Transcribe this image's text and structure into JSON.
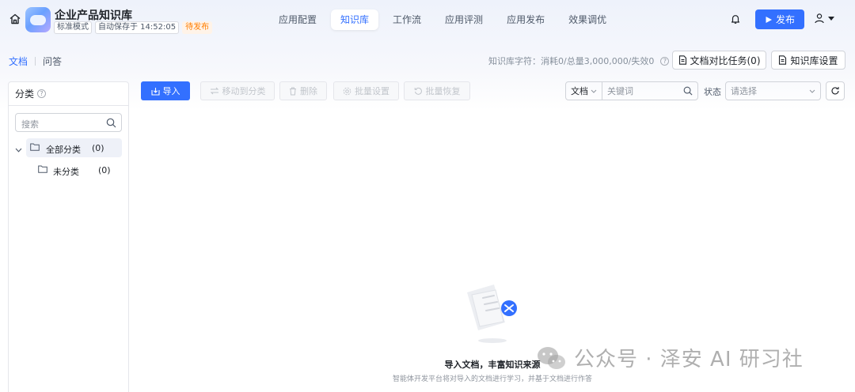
{
  "header": {
    "app_title": "企业产品知识库",
    "mode_tag": "标准模式",
    "autosave_tag": "自动保存于 14:52:05",
    "status_tag": "待发布",
    "publish_label": "发布"
  },
  "nav": {
    "tabs": [
      {
        "label": "应用配置"
      },
      {
        "label": "知识库",
        "active": true
      },
      {
        "label": "工作流"
      },
      {
        "label": "应用评测"
      },
      {
        "label": "应用发布"
      },
      {
        "label": "效果调优"
      }
    ]
  },
  "subnav": {
    "documents": "文档",
    "qa": "问答"
  },
  "stats": {
    "text": "知识库字符：消耗0/总量3,000,000/失效0",
    "compare_tasks_label": "文档对比任务(0)",
    "settings_label": "知识库设置"
  },
  "sidebar": {
    "heading": "分类",
    "search_placeholder": "搜索",
    "tree": [
      {
        "label": "全部分类",
        "count": "(0)"
      },
      {
        "label": "未分类",
        "count": "(0)"
      }
    ]
  },
  "toolbar": {
    "import_label": "导入",
    "move_label": "移动到分类",
    "delete_label": "删除",
    "batch_settings_label": "批量设置",
    "batch_restore_label": "批量恢复"
  },
  "filters": {
    "type_value": "文档",
    "keyword_placeholder": "关键词",
    "status_label": "状态",
    "status_placeholder": "请选择"
  },
  "empty_state": {
    "title": "导入文档，丰富知识来源",
    "description": "智能体开发平台将对导入的文档进行学习，并基于文档进行作答"
  },
  "watermark": {
    "text": "公众号 · 泽安 AI 研习社"
  },
  "colors": {
    "accent": "#3370ff",
    "pending": "#ff7d00"
  }
}
